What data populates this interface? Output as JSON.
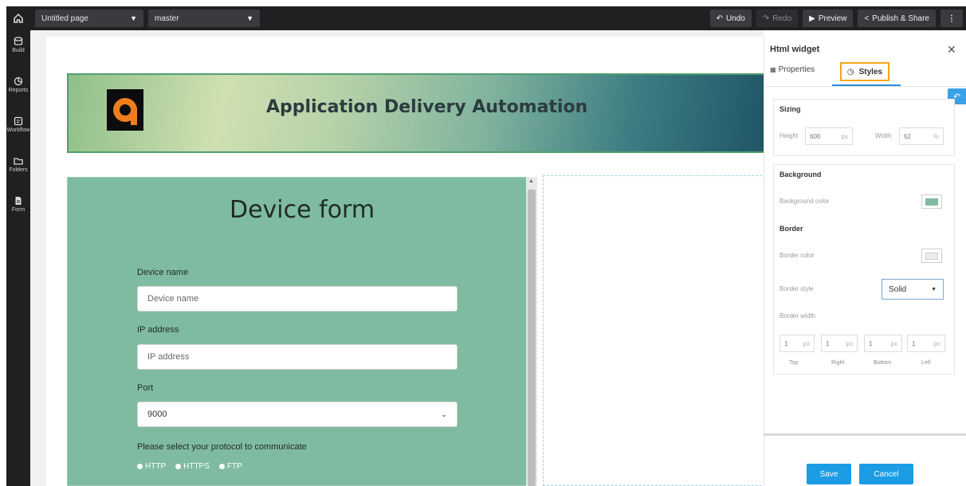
{
  "topbar": {
    "page_select": "Untitled page",
    "branch_select": "master",
    "undo": "Undo",
    "redo": "Redo",
    "preview": "Preview",
    "publish": "Publish & Share",
    "more": "⋮"
  },
  "sidebar": {
    "items": [
      {
        "label": "Build",
        "icon": "database-icon"
      },
      {
        "label": "Reports",
        "icon": "chart-icon"
      },
      {
        "label": "Workflow",
        "icon": "workflow-icon"
      },
      {
        "label": "Folders",
        "icon": "folder-icon"
      },
      {
        "label": "Form",
        "icon": "document-icon"
      }
    ]
  },
  "banner": {
    "logo_letter": "a",
    "title": "Application Delivery Automation",
    "logo_color": "#f07d1c"
  },
  "form": {
    "title": "Device form",
    "device_name_label": "Device name",
    "device_name_placeholder": "Device name",
    "ip_label": "IP address",
    "ip_placeholder": "IP address",
    "port_label": "Port",
    "port_value": "9000",
    "protocol_label": "Please select your protocol to communicate",
    "protocols": [
      "HTTP",
      "HTTPS",
      "FTP"
    ],
    "background_color": "#7fbba0"
  },
  "panel": {
    "title": "Html widget",
    "tab_properties": "Properties",
    "tab_styles": "Styles",
    "sizing_heading": "Sizing",
    "height_label": "Height",
    "height_value": "600",
    "height_unit": "px",
    "width_label": "Width",
    "width_value": "62",
    "width_unit": "%",
    "background_heading": "Background",
    "background_color_label": "Background color",
    "border_heading": "Border",
    "border_color_label": "Border color",
    "border_style_label": "Border style",
    "border_style_value": "Solid",
    "border_width_label": "Border width",
    "border_widths": [
      {
        "value": "1",
        "unit": "px",
        "side": "Top"
      },
      {
        "value": "1",
        "unit": "px",
        "side": "Right"
      },
      {
        "value": "1",
        "unit": "px",
        "side": "Bottom"
      },
      {
        "value": "1",
        "unit": "px",
        "side": "Left"
      }
    ],
    "save": "Save",
    "cancel": "Cancel",
    "accent_color": "#1b9ce5",
    "highlight_color": "#f2a81a"
  }
}
